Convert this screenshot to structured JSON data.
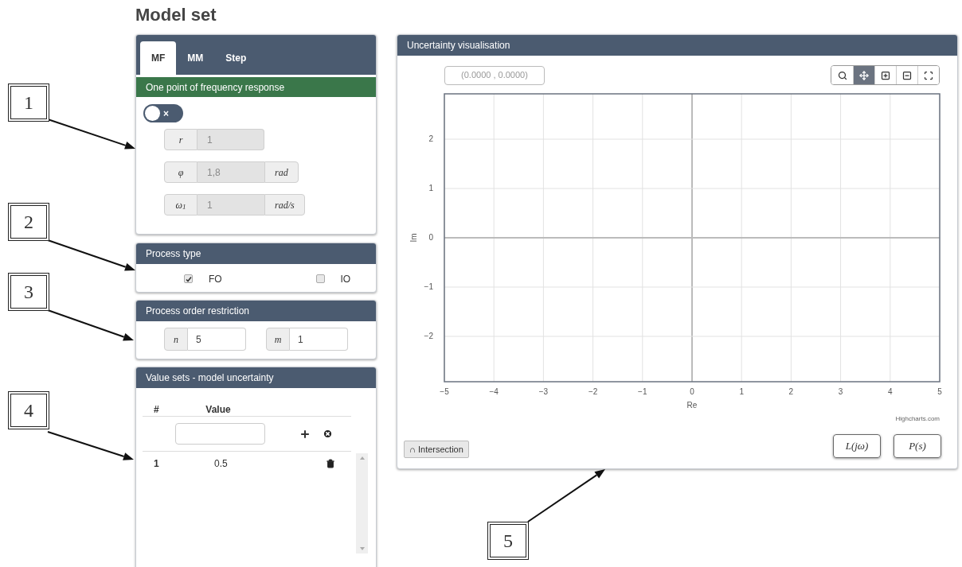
{
  "page_title": "Model set",
  "mf_panel": {
    "tabs": [
      {
        "label": "MF",
        "selected": true
      },
      {
        "label": "MM",
        "selected": false
      },
      {
        "label": "Step",
        "selected": false
      }
    ],
    "banner": "One point of frequency response",
    "toggle": {
      "on": false,
      "symbol": "×"
    },
    "inputs": [
      {
        "symbol": "r",
        "value": "1",
        "disabled": true
      },
      {
        "symbol": "φ",
        "value": "1,8",
        "unit": "rad",
        "disabled": true
      },
      {
        "symbol": "ω$_{1}$",
        "value": "1",
        "unit": "rad/s",
        "disabled": true
      }
    ]
  },
  "process_type": {
    "title": "Process type",
    "options": [
      {
        "label": "FO",
        "checked": true
      },
      {
        "label": "IO",
        "checked": false
      }
    ]
  },
  "order_restriction": {
    "title": "Process order restriction",
    "inputs": [
      {
        "symbol": "n",
        "value": "5"
      },
      {
        "symbol": "m",
        "value": "1"
      }
    ]
  },
  "value_sets": {
    "title": "Value sets - model uncertainty",
    "columns": [
      "#",
      "Value"
    ],
    "rows": [
      {
        "index": "1",
        "value": "0.5"
      }
    ]
  },
  "visualisation": {
    "title": "Uncertainty visualisation",
    "coordinates": "(0.0000 , 0.0000)",
    "tools": [
      {
        "kind": "search",
        "selected": false
      },
      {
        "kind": "pan",
        "selected": true
      },
      {
        "kind": "zoom-in",
        "selected": false
      },
      {
        "kind": "zoom-out",
        "selected": false
      },
      {
        "kind": "fullscreen",
        "selected": false
      }
    ],
    "chart_data": {
      "type": "scatter",
      "grid": true,
      "xlabel": "Re",
      "ylabel": "Im",
      "xlim": [
        -5,
        5
      ],
      "ylim": [
        -2.92,
        2.92
      ],
      "xticks": [
        {
          "value": -5,
          "label": "−5"
        },
        {
          "value": -4,
          "label": "−4"
        },
        {
          "value": -3,
          "label": "−3"
        },
        {
          "value": -2,
          "label": "−2"
        },
        {
          "value": -1,
          "label": "−1"
        },
        0,
        1,
        2,
        3,
        4,
        5
      ],
      "yticks": [
        {
          "value": -2,
          "label": "−2"
        },
        {
          "value": -1,
          "label": "−1"
        },
        0,
        1,
        2
      ]
    },
    "credit": "Highcharts.com",
    "intersection_button": "∩ Intersection",
    "plot_buttons": [
      "L(jω)",
      "P(s)"
    ]
  },
  "callouts": [
    {
      "label": "1"
    },
    {
      "label": "2"
    },
    {
      "label": "3"
    },
    {
      "label": "4"
    },
    {
      "label": "5"
    }
  ]
}
